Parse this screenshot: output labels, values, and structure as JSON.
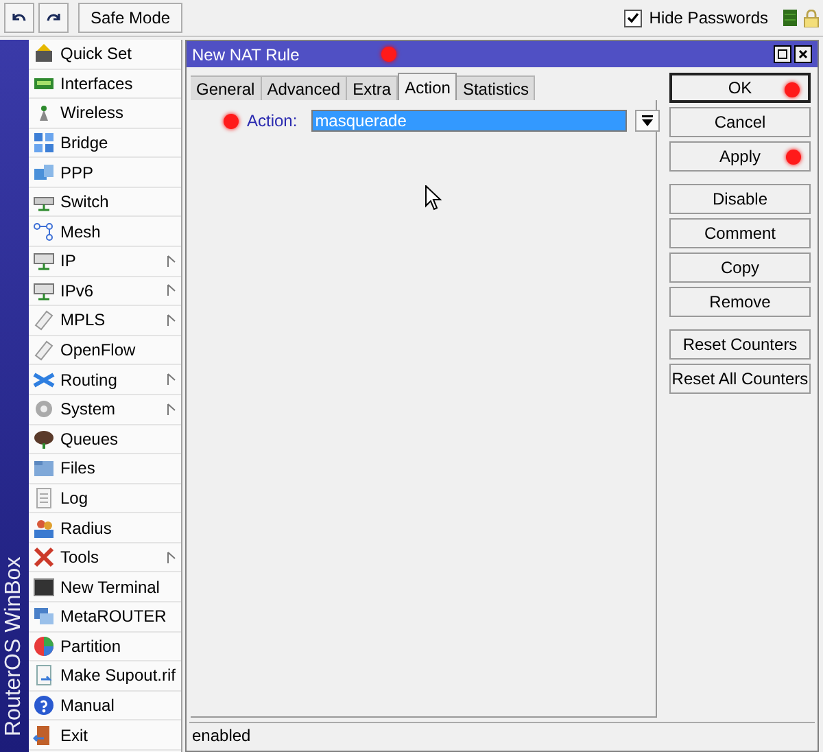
{
  "toolbar": {
    "safe_mode": "Safe Mode",
    "hide_passwords": {
      "label": "Hide Passwords",
      "checked": true
    }
  },
  "brand": "RouterOS WinBox",
  "sidebar": {
    "items": [
      {
        "label": "Quick Set",
        "submenu": false
      },
      {
        "label": "Interfaces",
        "submenu": false
      },
      {
        "label": "Wireless",
        "submenu": false
      },
      {
        "label": "Bridge",
        "submenu": false
      },
      {
        "label": "PPP",
        "submenu": false
      },
      {
        "label": "Switch",
        "submenu": false
      },
      {
        "label": "Mesh",
        "submenu": false
      },
      {
        "label": "IP",
        "submenu": true
      },
      {
        "label": "IPv6",
        "submenu": true
      },
      {
        "label": "MPLS",
        "submenu": true
      },
      {
        "label": "OpenFlow",
        "submenu": false
      },
      {
        "label": "Routing",
        "submenu": true
      },
      {
        "label": "System",
        "submenu": true
      },
      {
        "label": "Queues",
        "submenu": false
      },
      {
        "label": "Files",
        "submenu": false
      },
      {
        "label": "Log",
        "submenu": false
      },
      {
        "label": "Radius",
        "submenu": false
      },
      {
        "label": "Tools",
        "submenu": true
      },
      {
        "label": "New Terminal",
        "submenu": false
      },
      {
        "label": "MetaROUTER",
        "submenu": false
      },
      {
        "label": "Partition",
        "submenu": false
      },
      {
        "label": "Make Supout.rif",
        "submenu": false
      },
      {
        "label": "Manual",
        "submenu": false
      },
      {
        "label": "Exit",
        "submenu": false
      }
    ]
  },
  "window": {
    "title": "New NAT Rule",
    "marked": true,
    "tabs": [
      {
        "label": "General",
        "selected": false
      },
      {
        "label": "Advanced",
        "selected": false
      },
      {
        "label": "Extra",
        "selected": false
      },
      {
        "label": "Action",
        "selected": true
      },
      {
        "label": "Statistics",
        "selected": false
      }
    ],
    "action": {
      "label": "Action:",
      "value": "masquerade",
      "marked": true
    },
    "button_groups": [
      {
        "buttons": [
          {
            "label": "OK",
            "marked": true,
            "default": true
          },
          {
            "label": "Cancel",
            "marked": false,
            "default": false
          },
          {
            "label": "Apply",
            "marked": true,
            "default": false
          }
        ]
      },
      {
        "buttons": [
          {
            "label": "Disable",
            "marked": false,
            "default": false
          },
          {
            "label": "Comment",
            "marked": false,
            "default": false
          },
          {
            "label": "Copy",
            "marked": false,
            "default": false
          },
          {
            "label": "Remove",
            "marked": false,
            "default": false
          }
        ]
      },
      {
        "buttons": [
          {
            "label": "Reset Counters",
            "marked": false,
            "default": false
          },
          {
            "label": "Reset All Counters",
            "marked": false,
            "default": false
          }
        ]
      }
    ],
    "status_bar": "enabled"
  }
}
